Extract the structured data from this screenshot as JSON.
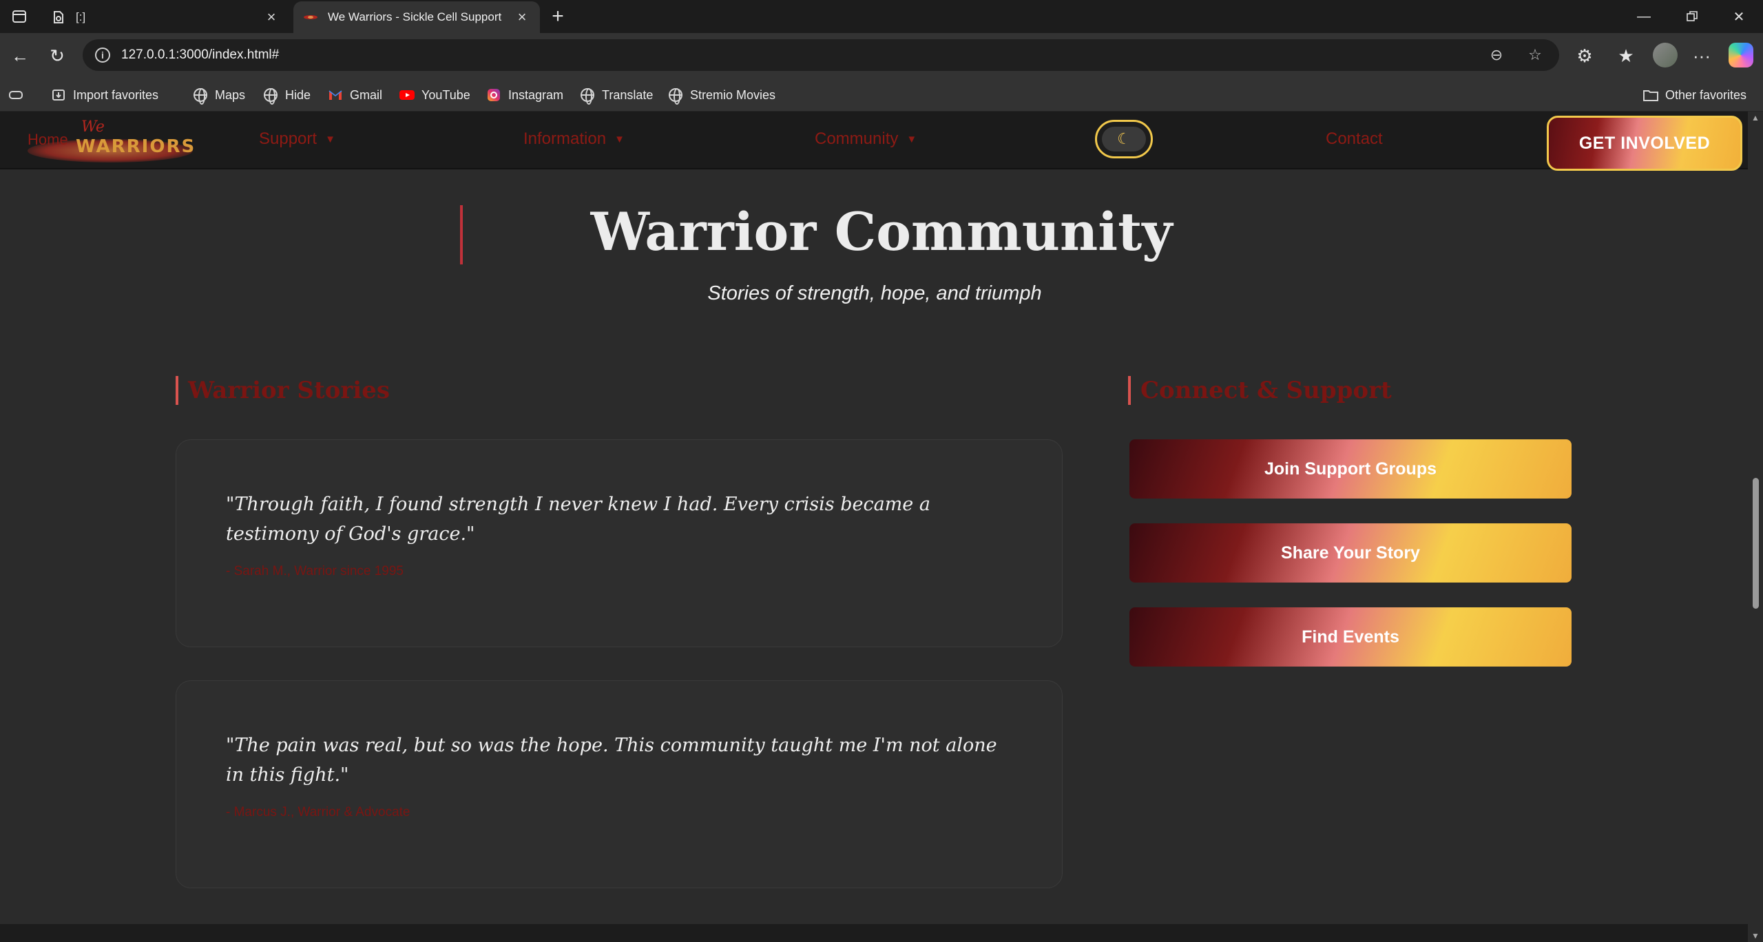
{
  "browser": {
    "tabs": [
      {
        "title": "[:]",
        "active": false
      },
      {
        "title": "We Warriors - Sickle Cell Support",
        "active": true
      }
    ],
    "url": "127.0.0.1:3000/index.html#",
    "bookmarks": [
      {
        "label": "Import favorites",
        "icon": "import-icon"
      },
      {
        "label": "Maps",
        "icon": "globe-icon"
      },
      {
        "label": "Hide",
        "icon": "globe-icon"
      },
      {
        "label": "Gmail",
        "icon": "gmail-icon"
      },
      {
        "label": "YouTube",
        "icon": "youtube-icon"
      },
      {
        "label": "Instagram",
        "icon": "instagram-icon"
      },
      {
        "label": "Translate",
        "icon": "globe-icon"
      },
      {
        "label": "Stremio Movies",
        "icon": "globe-icon"
      }
    ],
    "other_favorites": "Other favorites"
  },
  "site": {
    "logo": {
      "line1": "We",
      "line2": "WARRIORS"
    },
    "home_link": "Home",
    "nav": [
      {
        "label": "Support",
        "caret": "▼"
      },
      {
        "label": "Information",
        "caret": "▼"
      },
      {
        "label": "Community",
        "caret": "▼"
      },
      {
        "label": "Contact"
      }
    ],
    "theme_toggle_glyph": "☾",
    "cta": "GET INVOLVED"
  },
  "hero": {
    "title": "Warrior Community",
    "subtitle": "Stories of strength, hope, and triumph"
  },
  "stories": {
    "heading": "Warrior Stories",
    "items": [
      {
        "quote": "\"Through faith, I found strength I never knew I had. Every crisis became a testimony of God's grace.\"",
        "author": "- Sarah M., Warrior since 1995"
      },
      {
        "quote": "\"The pain was real, but so was the hope. This community taught me I'm not alone in this fight.\"",
        "author": "- Marcus J., Warrior & Advocate"
      }
    ]
  },
  "connect": {
    "heading": "Connect & Support",
    "buttons": [
      "Join Support Groups",
      "Share Your Story",
      "Find Events"
    ]
  },
  "colors": {
    "accent_red": "#8e1a14",
    "accent_gold": "#f2c94c",
    "page_bg": "#2b2b2b"
  }
}
